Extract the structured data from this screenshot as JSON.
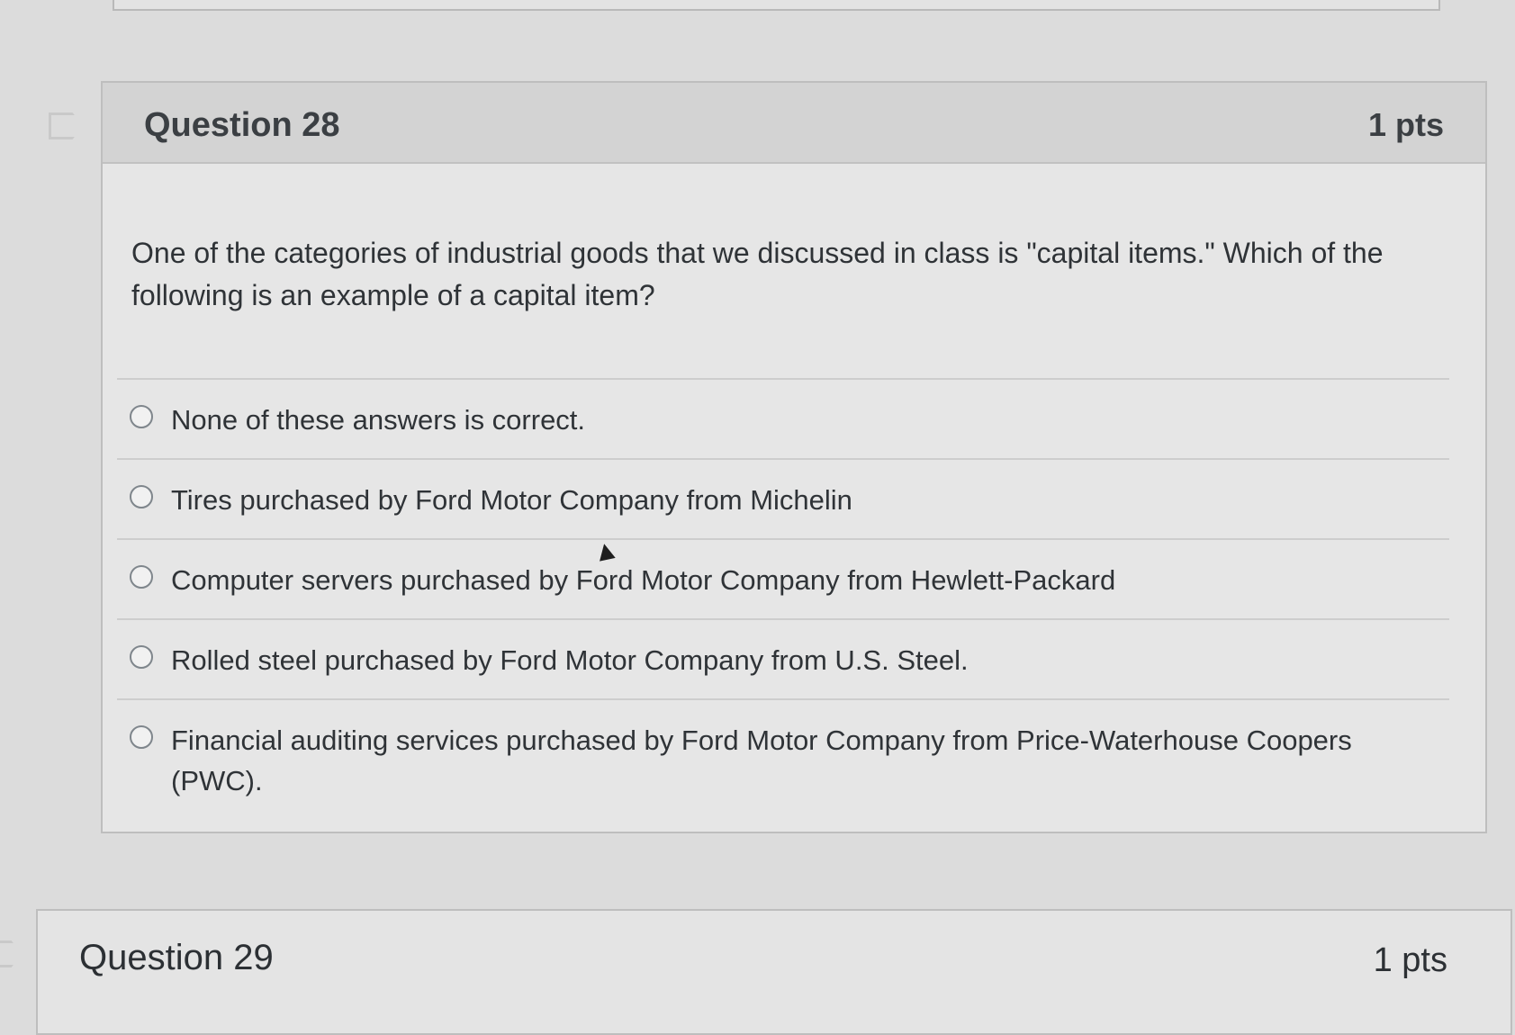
{
  "question_28": {
    "title": "Question 28",
    "points": "1 pts",
    "text": "One of the categories of industrial goods that we discussed in class is \"capital items.\" Which of the following is an example of a capital item?",
    "answers": [
      "None of these answers is correct.",
      "Tires purchased by Ford Motor Company from Michelin",
      "Computer servers purchased by Ford Motor Company from Hewlett-Packard",
      "Rolled steel purchased by Ford Motor Company from U.S. Steel.",
      "Financial auditing services purchased by Ford Motor Company from Price-Waterhouse Coopers (PWC)."
    ]
  },
  "question_29": {
    "title": "Question 29",
    "points": "1 pts"
  },
  "colors": {
    "page_background": "#dcdcdc",
    "header_background": "#d3d3d3",
    "card_background": "#e6e6e6",
    "text": "#2f3337"
  },
  "icons": {
    "flag": "flag-question-icon",
    "radio": "radio-button-icon",
    "cursor": "mouse-pointer-icon"
  }
}
